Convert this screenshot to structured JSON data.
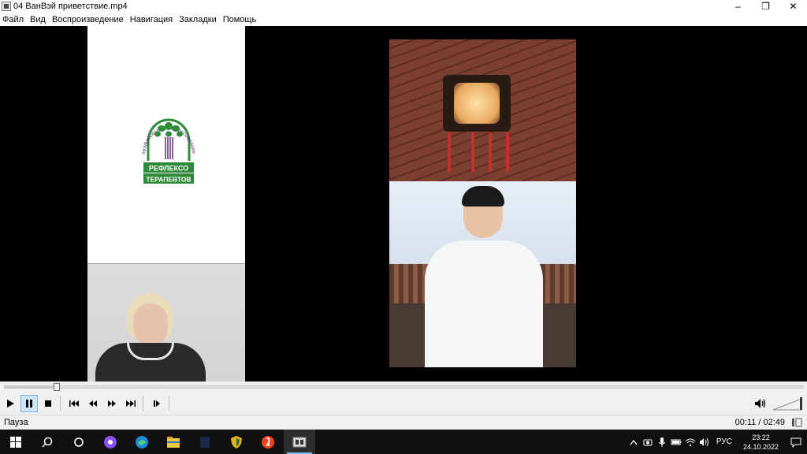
{
  "window": {
    "title": "04 ВанВэй приветствие.mp4",
    "buttons": {
      "minimize": "–",
      "maximize": "❐",
      "close": "✕"
    }
  },
  "menubar": {
    "items": [
      "Файл",
      "Вид",
      "Воспроизведение",
      "Навигация",
      "Закладки",
      "Помощь"
    ]
  },
  "slide": {
    "logo_text": {
      "arc": "профессиональная ассоциация",
      "line1": "РЕФЛЕКСО",
      "line2": "ТЕРАПЕВТОВ"
    },
    "colors": {
      "green": "#2e8b3a",
      "purple": "#6a2a7a"
    }
  },
  "player": {
    "progress_fraction": 0.065,
    "state": "paused",
    "status_text": "Пауза",
    "time_current": "00:11",
    "time_total": "02:49",
    "time_display": "00:11 / 02:49"
  },
  "controls": {
    "icons": [
      "play-icon",
      "pause-icon",
      "stop-icon",
      "previous-icon",
      "rewind-icon",
      "fast-forward-icon",
      "next-icon",
      "frame-step-icon"
    ]
  },
  "taskbar": {
    "apps": [
      "start-icon",
      "search-icon",
      "cortana-icon",
      "alice-icon",
      "edge-icon",
      "file-explorer-icon",
      "dark-app-icon",
      "shield-app-icon",
      "yandex-browser-icon",
      "media-player-icon"
    ],
    "language": "РУС",
    "time": "23:22",
    "date": "24.10.2022"
  }
}
